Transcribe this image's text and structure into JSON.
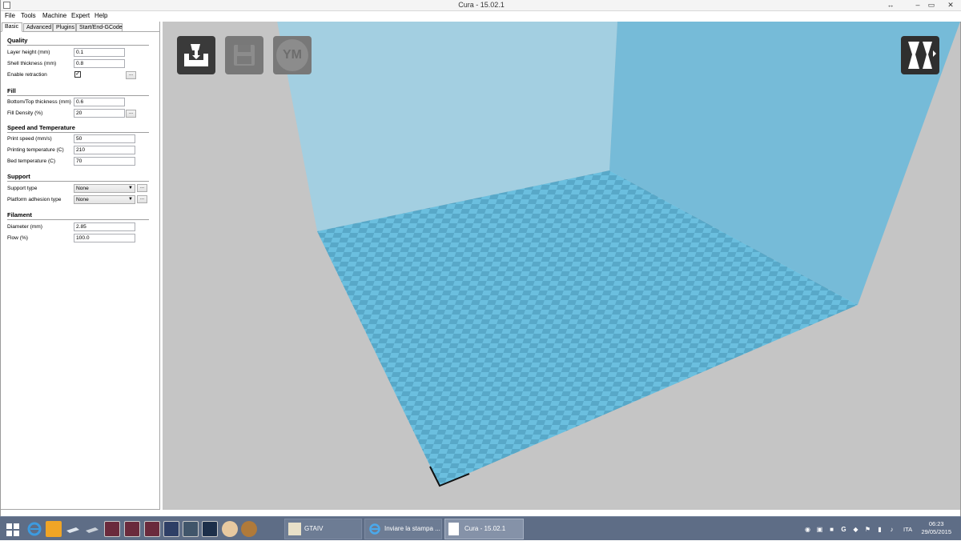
{
  "window": {
    "title": "Cura - 15.02.1",
    "controls": {
      "resize": "↔",
      "minimize": "–",
      "maximize": "▭",
      "close": "✕"
    }
  },
  "menubar": [
    "File",
    "Tools",
    "Machine",
    "Expert",
    "Help"
  ],
  "tabs": [
    "Basic",
    "Advanced",
    "Plugins",
    "Start/End-GCode"
  ],
  "active_tab": "Basic",
  "settings": {
    "quality": {
      "title": "Quality",
      "layer_height": {
        "label": "Layer height (mm)",
        "value": "0.1"
      },
      "shell_thickness": {
        "label": "Shell thickness (mm)",
        "value": "0.8"
      },
      "enable_retraction": {
        "label": "Enable retraction",
        "checked": "✓",
        "button": "..."
      }
    },
    "fill": {
      "title": "Fill",
      "bottom_top": {
        "label": "Bottom/Top thickness (mm)",
        "value": "0.6"
      },
      "density": {
        "label": "Fill Density (%)",
        "value": "20",
        "button": "..."
      }
    },
    "speed": {
      "title": "Speed and Temperature",
      "print_speed": {
        "label": "Print speed (mm/s)",
        "value": "50"
      },
      "print_temp": {
        "label": "Printing temperature (C)",
        "value": "210"
      },
      "bed_temp": {
        "label": "Bed temperature (C)",
        "value": "70"
      }
    },
    "support": {
      "title": "Support",
      "support_type": {
        "label": "Support type",
        "value": "None",
        "button": "..."
      },
      "adhesion": {
        "label": "Platform adhesion type",
        "value": "None",
        "button": "..."
      }
    },
    "filament": {
      "title": "Filament",
      "diameter": {
        "label": "Diameter (mm)",
        "value": "2.85"
      },
      "flow": {
        "label": "Flow (%)",
        "value": "100.0"
      }
    }
  },
  "viewport": {
    "toolbar": {
      "load_icon": "load-model-icon",
      "save_icon": "save-disk-icon",
      "ym_label": "YM",
      "view_icon": "view-mode-icon"
    },
    "colors": {
      "background": "#c5c5c5",
      "walls": "#7bbfdb",
      "wall_back": "#a7d2e3",
      "bed_light": "#6bbfdf",
      "bed_dark": "#5aa9c8"
    }
  },
  "taskbar": {
    "tasks": [
      {
        "label": "GTAIV",
        "icon": "gtaiv-icon"
      },
      {
        "label": "Inviare la stampa ...",
        "icon": "ie-icon"
      },
      {
        "label": "Cura - 15.02.1",
        "icon": "document-icon"
      }
    ],
    "language": "ITA",
    "time": "06:23",
    "date": "29/05/2015"
  }
}
